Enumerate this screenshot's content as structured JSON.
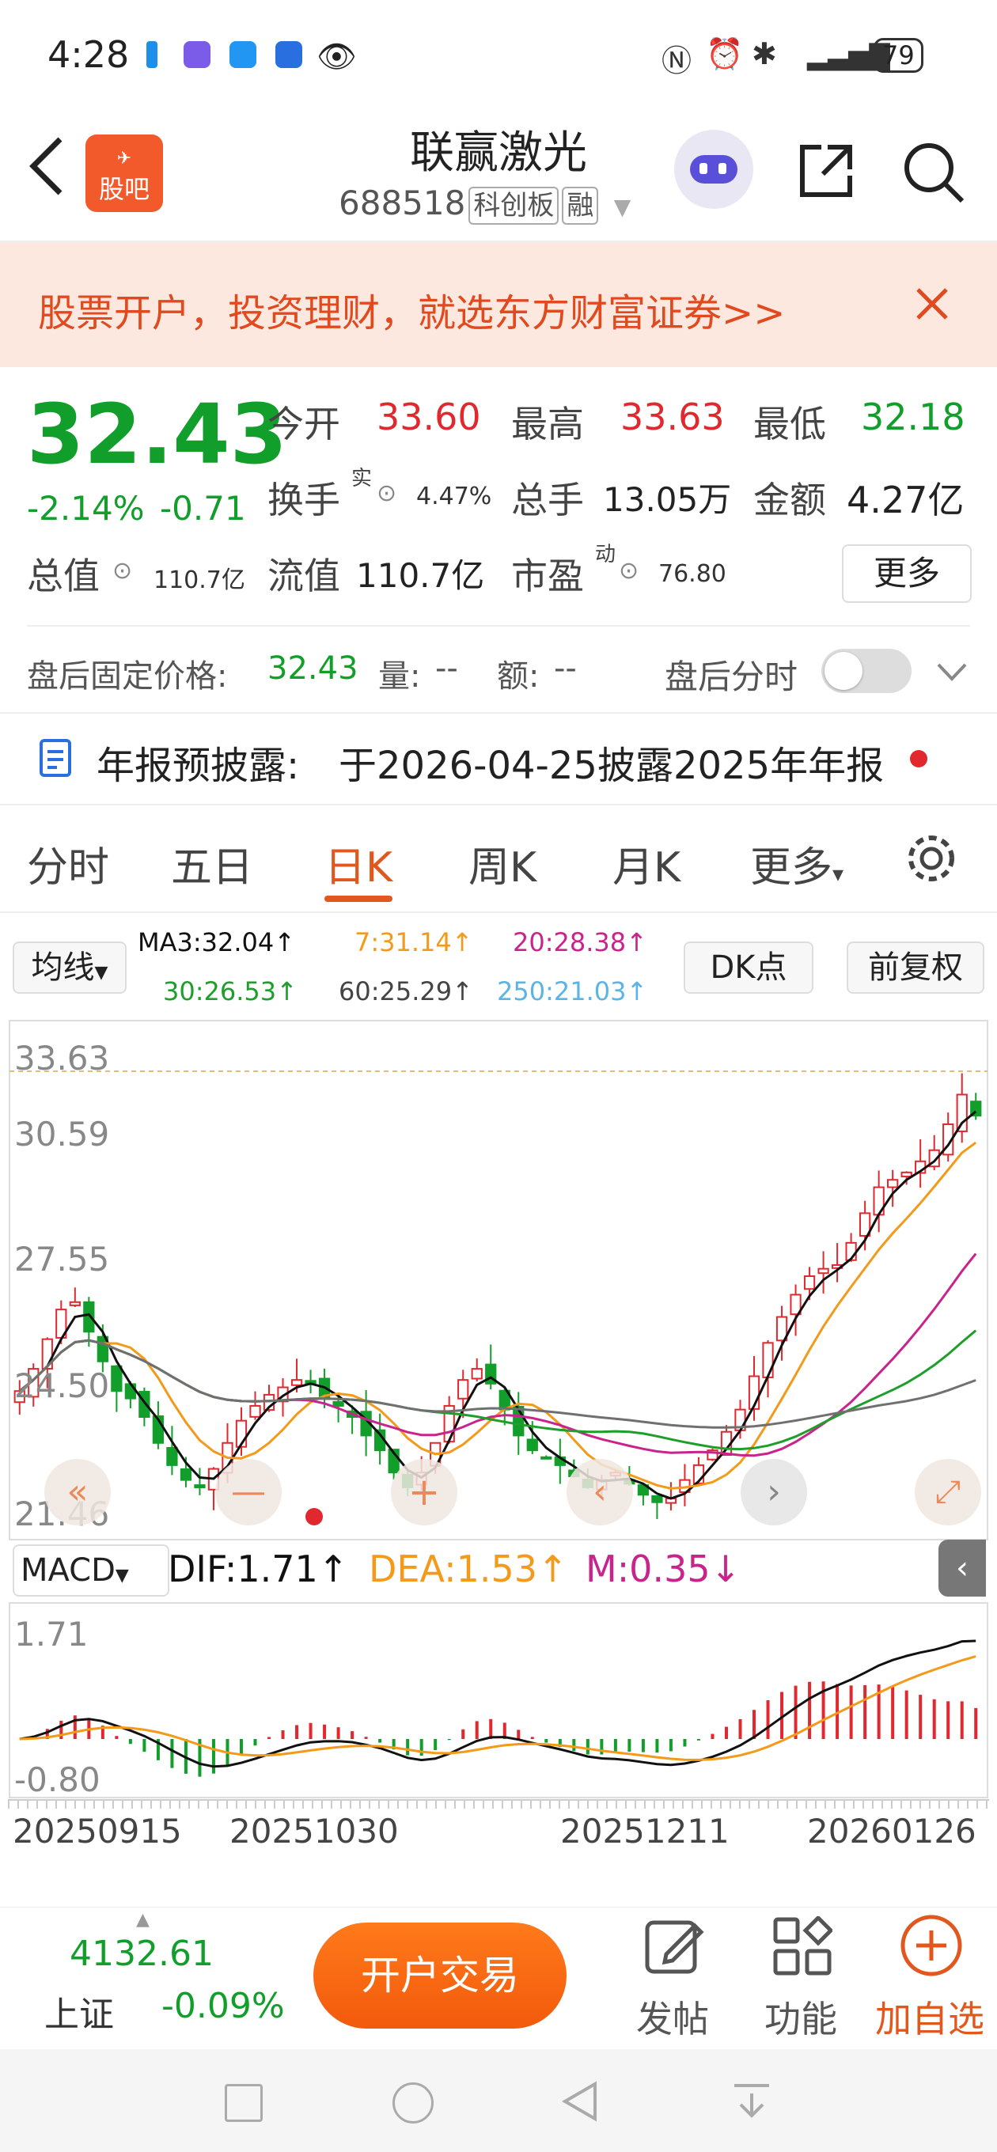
{
  "status_bar": {
    "time": "4:28",
    "battery": "79"
  },
  "header": {
    "logo_label": "股吧",
    "stock_name": "联赢激光",
    "stock_code": "688518",
    "tag_board": "科创板",
    "tag_margin": "融"
  },
  "banner": {
    "text": "股票开户，投资理财，就选东方财富证券>>"
  },
  "quote": {
    "price": "32.43",
    "change_pct": "-2.14%",
    "change": "-0.71",
    "open_label": "今开",
    "open": "33.60",
    "high_label": "最高",
    "high": "33.63",
    "low_label": "最低",
    "low": "32.18",
    "turnover_label": "换手",
    "turnover_sup": "实",
    "turnover": "4.47%",
    "volume_label": "总手",
    "volume": "13.05万",
    "amount_label": "金额",
    "amount": "4.27亿",
    "mktcap_label": "总值",
    "mktcap": "110.7亿",
    "float_label": "流值",
    "float": "110.7亿",
    "pe_label": "市盈",
    "pe_sup": "动",
    "pe": "76.80",
    "more_button": "更多"
  },
  "after_hours": {
    "fixed_label": "盘后固定价格:",
    "fixed_price": "32.43",
    "vol_label": "量:",
    "vol": "--",
    "amt_label": "额:",
    "amt": "--",
    "intraday_label": "盘后分时"
  },
  "notice": {
    "label": "年报预披露:",
    "text": "于2026-04-25披露2025年年报"
  },
  "tabs": [
    "分时",
    "五日",
    "日K",
    "周K",
    "月K",
    "更多"
  ],
  "indicator_bar": {
    "ma_select": "均线",
    "ma3": "MA3:32.04↑",
    "ma7": "7:31.14↑",
    "ma20": "20:28.38↑",
    "ma30": "30:26.53↑",
    "ma60": "60:25.29↑",
    "ma250": "250:21.03↑",
    "dk_button": "DK点",
    "adjust_button": "前复权"
  },
  "colors": {
    "up": "#e0282e",
    "down": "#129e2a",
    "ma3": "#111111",
    "ma7": "#f39a1a",
    "ma20": "#c8248c",
    "ma30": "#1e9e2a",
    "ma60": "#707070",
    "ma250": "#5ab4e6",
    "accent": "#e2571e"
  },
  "chart_data": [
    {
      "type": "candlestick",
      "y_axis_labels": [
        "33.63",
        "30.59",
        "27.55",
        "24.50",
        "21.46"
      ],
      "ylim": [
        21.46,
        33.63
      ],
      "series_names": [
        "MA3",
        "7",
        "20",
        "30",
        "60",
        "250"
      ],
      "close": [
        25.0,
        25.6,
        26.4,
        27.2,
        27.4,
        26.6,
        25.8,
        25.0,
        24.8,
        24.3,
        23.6,
        23.0,
        22.6,
        22.4,
        22.9,
        23.6,
        24.2,
        24.6,
        24.9,
        25.1,
        25.3,
        25.2,
        24.8,
        24.6,
        24.3,
        23.8,
        23.4,
        22.8,
        22.4,
        22.8,
        23.6,
        24.6,
        25.3,
        25.6,
        25.2,
        24.5,
        23.8,
        23.4,
        23.2,
        23.0,
        22.7,
        22.4,
        22.6,
        22.8,
        22.5,
        22.2,
        22.0,
        22.1,
        22.6,
        23.0,
        23.4,
        23.9,
        24.5,
        25.4,
        26.3,
        27.0,
        27.6,
        28.1,
        28.3,
        28.4,
        29.0,
        29.8,
        30.5,
        30.7,
        30.9,
        31.2,
        31.5,
        32.2,
        33.0,
        32.43
      ],
      "x_tick_labels": [
        "20250915",
        "20251030",
        "20251211",
        "20260126"
      ]
    },
    {
      "type": "bar",
      "name": "MACD",
      "dif": "1.71",
      "dea": "1.53",
      "m": "0.35",
      "y_axis_labels": [
        "1.71",
        "-0.80"
      ],
      "ylim": [
        -0.8,
        1.71
      ]
    }
  ],
  "macd_bar": {
    "select": "MACD",
    "dif": "DIF:1.71↑",
    "dea": "DEA:1.53↑",
    "m": "M:0.35↓"
  },
  "bottom": {
    "index_value": "4132.61",
    "index_name": "上证",
    "index_change": "-0.09%",
    "trade_button": "开户交易",
    "post": "发帖",
    "functions": "功能",
    "add_watch": "加自选"
  }
}
